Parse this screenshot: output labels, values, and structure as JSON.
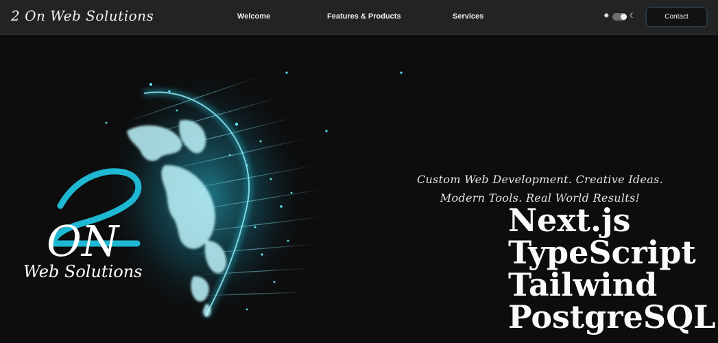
{
  "navbar": {
    "brand": "2 On Web Solutions",
    "links": [
      {
        "label": "Welcome"
      },
      {
        "label": "Features & Products"
      },
      {
        "label": "Services"
      }
    ],
    "theme_toggle": {
      "light_icon": "sun-icon",
      "dark_icon": "moon-icon",
      "mode": "dark"
    },
    "contact_label": "Contact"
  },
  "hero": {
    "logo": {
      "initials": "2ON",
      "subtitle": "Web Solutions"
    },
    "tagline_line1": "Custom Web Development. Creative Ideas.",
    "tagline_line2": "Modern Tools. Real World Results!",
    "tech_stack": [
      "Next.js",
      "TypeScript",
      "Tailwind",
      "PostgreSQL"
    ]
  },
  "colors": {
    "background": "#0d0d0e",
    "navbar": "#232324",
    "accent": "#1fb8d3",
    "text": "#ffffff"
  }
}
